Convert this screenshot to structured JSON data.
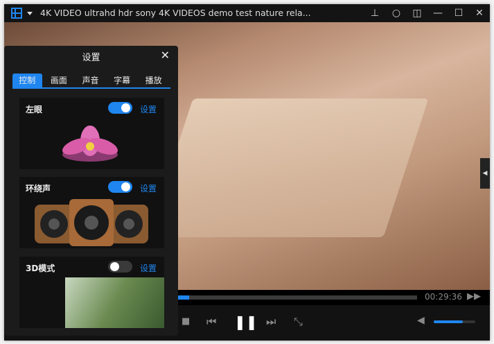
{
  "window": {
    "title": "4K VIDEO ultrahd hdr sony 4K VIDEOS demo test nature rela...",
    "buttons": [
      "pin-icon",
      "bulb-icon",
      "mini-mode-icon",
      "minimize-icon",
      "maximize-icon",
      "close-icon"
    ]
  },
  "player": {
    "time": "00:29:36",
    "progress_percent": 44,
    "volume_percent": 70
  },
  "settings": {
    "title": "设置",
    "tabs": [
      "控制",
      "画面",
      "声音",
      "字幕",
      "播放"
    ],
    "active_tab": "控制",
    "cards": [
      {
        "label": "左眼",
        "enabled": true,
        "action": "设置"
      },
      {
        "label": "环绕声",
        "enabled": true,
        "action": "设置"
      },
      {
        "label": "3D模式",
        "enabled": false,
        "action": "设置"
      }
    ]
  },
  "colors": {
    "accent": "#1f86f0"
  }
}
